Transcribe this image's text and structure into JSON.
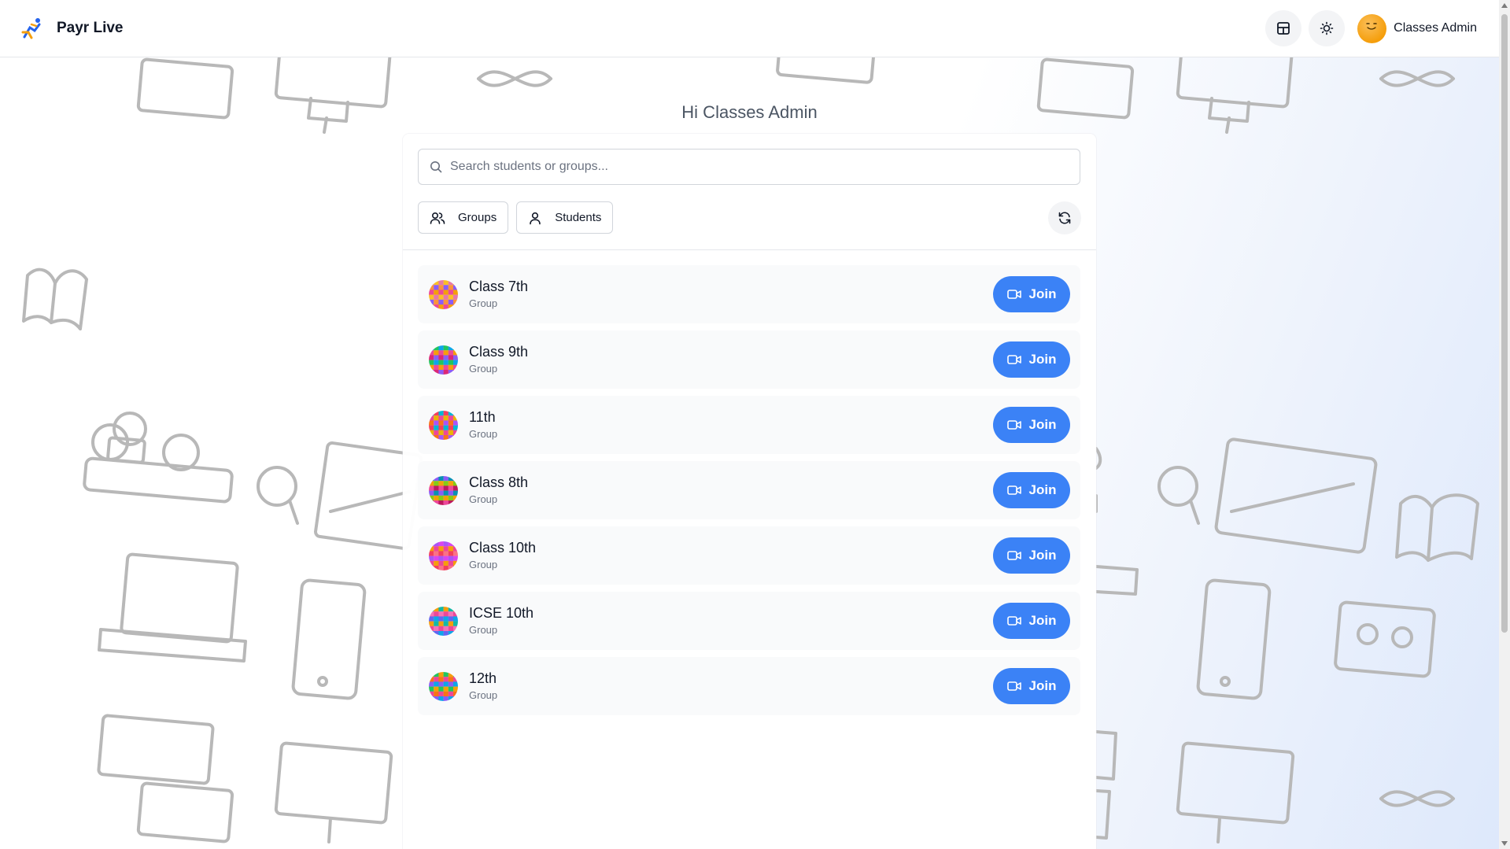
{
  "app": {
    "title": "Payr Live"
  },
  "header": {
    "user_name": "Classes Admin",
    "icons": [
      "layout-icon",
      "sun-icon"
    ]
  },
  "greeting": "Hi Classes Admin",
  "search": {
    "placeholder": "Search students or groups...",
    "value": ""
  },
  "filters": [
    {
      "label": "Groups",
      "icon": "users-icon"
    },
    {
      "label": "Students",
      "icon": "user-icon"
    }
  ],
  "rows": [
    {
      "title": "Class 7th",
      "subtitle": "Group",
      "action": "Join"
    },
    {
      "title": "Class 9th",
      "subtitle": "Group",
      "action": "Join"
    },
    {
      "title": "11th",
      "subtitle": "Group",
      "action": "Join"
    },
    {
      "title": "Class 8th",
      "subtitle": "Group",
      "action": "Join"
    },
    {
      "title": "Class 10th",
      "subtitle": "Group",
      "action": "Join"
    },
    {
      "title": "ICSE 10th",
      "subtitle": "Group",
      "action": "Join"
    },
    {
      "title": "12th",
      "subtitle": "Group",
      "action": "Join"
    }
  ],
  "colors": {
    "accent": "#3b82f6",
    "background_tint": "#dde8fb",
    "avatar": "#f59e0b"
  }
}
